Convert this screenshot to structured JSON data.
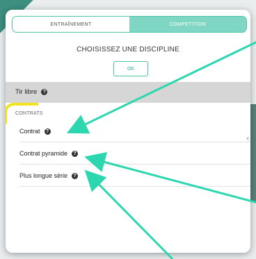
{
  "mode_toggle": {
    "training_label": "ENTRAÎNEMENT",
    "competition_label": "COMPETITION"
  },
  "discipline": {
    "title": "CHOISISSEZ UNE DISCIPLINE",
    "ok_label": "OK"
  },
  "free_throw": {
    "label": "Tir libre"
  },
  "contracts": {
    "section_label": "CONTRATS",
    "items": [
      {
        "label": "Contrat"
      },
      {
        "label": "Contrat pyramide"
      },
      {
        "label": "Plus longue série"
      }
    ]
  },
  "help_glyph": "?",
  "annotation_colors": {
    "arrow": "#2cd7b0",
    "highlight": "#f3e21c"
  }
}
